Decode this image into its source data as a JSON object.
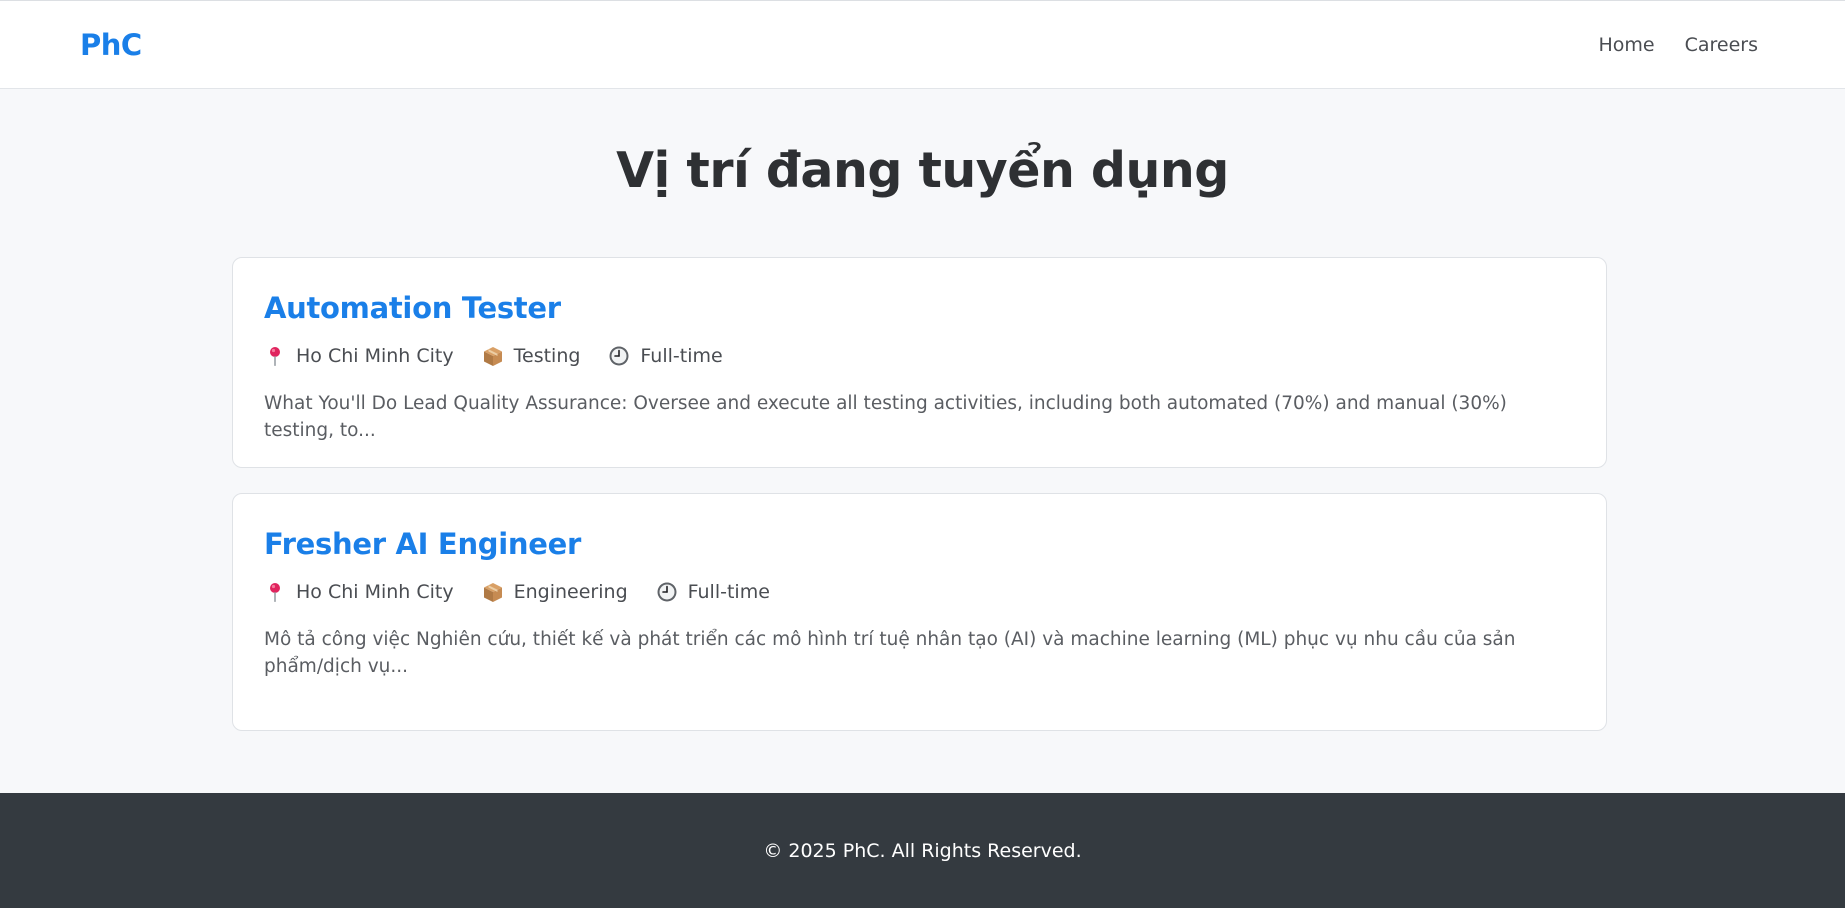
{
  "header": {
    "brand": "PhC",
    "nav": [
      {
        "label": "Home"
      },
      {
        "label": "Careers"
      }
    ]
  },
  "main": {
    "title": "Vị trí đang tuyển dụng",
    "jobs": [
      {
        "title": "Automation Tester",
        "location": "Ho Chi Minh City",
        "department": "Testing",
        "type": "Full-time",
        "description": "What You'll Do Lead Quality Assurance: Oversee and execute all testing activities, including both automated (70%) and manual (30%) testing, to..."
      },
      {
        "title": "Fresher AI Engineer",
        "location": "Ho Chi Minh City",
        "department": "Engineering",
        "type": "Full-time",
        "description": "Mô tả công việc Nghiên cứu, thiết kế và phát triển các mô hình trí tuệ nhân tạo (AI) và machine learning (ML) phục vụ nhu cầu của sản phẩm/dịch vụ..."
      }
    ]
  },
  "icons": {
    "location": "map-pin-icon",
    "department": "package-icon",
    "type": "clock-icon"
  },
  "colors": {
    "accent": "#1a7fe8",
    "footer_bg": "#343a40",
    "page_bg": "#f7f8fa"
  },
  "footer": {
    "text": "© 2025 PhC. All Rights Reserved."
  }
}
